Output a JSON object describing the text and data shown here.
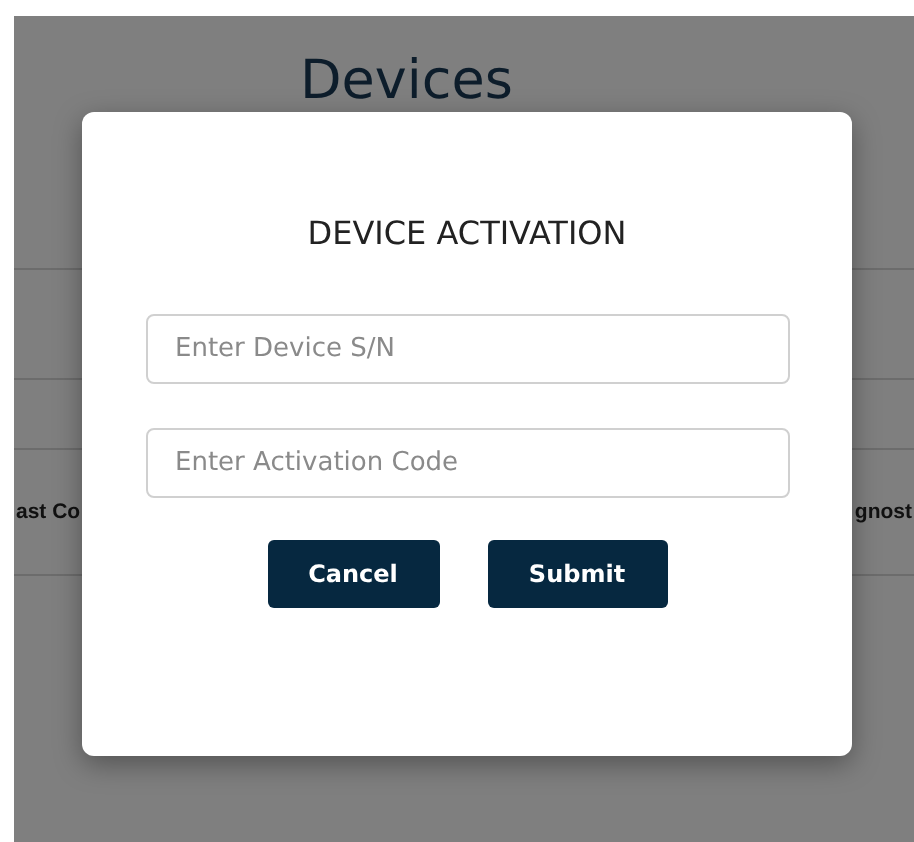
{
  "background": {
    "heading": "Devices",
    "columns": [
      "ast Co",
      "gnost"
    ]
  },
  "dialog": {
    "title": "DEVICE ACTIVATION",
    "fields": [
      {
        "placeholder": "Enter Device S/N"
      },
      {
        "placeholder": "Enter Activation Code"
      }
    ],
    "buttons": [
      "Cancel",
      "Submit"
    ]
  }
}
